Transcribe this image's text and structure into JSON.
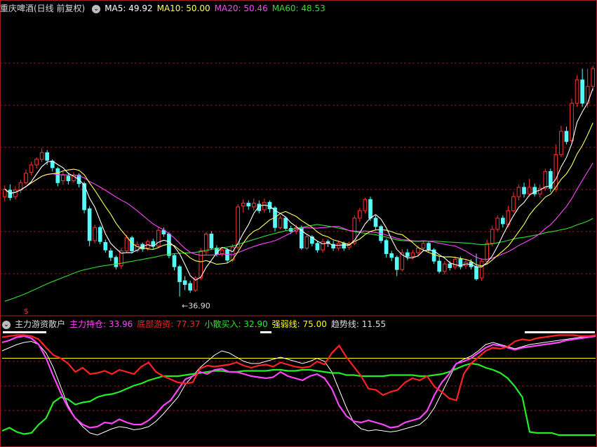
{
  "main_header": {
    "title": "重庆啤酒(日线 前复权)",
    "ma5_label": "MA5: 49.92",
    "ma10_label": "MA10: 50.00",
    "ma20_label": "MA20: 50.46",
    "ma60_label": "MA60: 48.53",
    "min_price_label": "←36.90"
  },
  "sub_header": {
    "title": "主力游资散户",
    "l1": "主力持仓: 33.96",
    "l2": "底部游资: 77.37",
    "l3": "小散买入: 32.90",
    "l4": "强弱线: 75.00",
    "l5": "趋势线: 11.55",
    "marker": "$"
  },
  "colors": {
    "up": "#ff3232",
    "down": "#54fcfc",
    "ma5": "#ffffff",
    "ma10": "#ffff55",
    "ma20": "#ff44ff",
    "ma60": "#33dd33",
    "zhuli": "#ff44ff",
    "youzi": "#ff2222",
    "xiaosan": "#22ee22",
    "qiangruo": "#ffff00",
    "qushi": "#ffffff",
    "grid": "#8b1a1a"
  },
  "chart_data": [
    {
      "type": "candlestick",
      "title": "重庆啤酒(日线 前复权)",
      "ylim": [
        35,
        67
      ],
      "annotations": [
        {
          "label": "←36.90",
          "value": 36.9
        }
      ],
      "candles": [
        [
          47.6,
          48.4,
          47.1,
          48.8
        ],
        [
          48.3,
          47.5,
          47.2,
          48.9
        ],
        [
          47.6,
          48.3,
          47.3,
          48.7
        ],
        [
          48.3,
          49.1,
          48.0,
          49.4
        ],
        [
          49.1,
          50.1,
          48.9,
          50.5
        ],
        [
          50.2,
          51.0,
          49.9,
          51.3
        ],
        [
          51.0,
          51.6,
          50.6,
          51.8
        ],
        [
          51.6,
          52.3,
          51.3,
          52.8
        ],
        [
          52.3,
          51.5,
          51.0,
          52.6
        ],
        [
          51.4,
          50.7,
          50.3,
          51.6
        ],
        [
          50.6,
          49.1,
          48.7,
          50.8
        ],
        [
          49.3,
          49.9,
          48.9,
          50.3
        ],
        [
          49.8,
          49.3,
          48.9,
          50.1
        ],
        [
          49.3,
          49.9,
          49.1,
          50.2
        ],
        [
          49.9,
          49.0,
          48.6,
          50.1
        ],
        [
          49.0,
          46.2,
          45.8,
          49.2
        ],
        [
          46.3,
          42.9,
          42.3,
          46.6
        ],
        [
          42.9,
          44.3,
          42.6,
          44.6
        ],
        [
          44.3,
          42.8,
          42.5,
          44.5
        ],
        [
          42.7,
          41.9,
          41.6,
          43.0
        ],
        [
          41.8,
          41.1,
          40.7,
          42.1
        ],
        [
          41.1,
          40.1,
          39.8,
          41.3
        ],
        [
          40.2,
          41.8,
          39.9,
          42.1
        ],
        [
          41.8,
          43.2,
          41.6,
          43.5
        ],
        [
          43.2,
          41.8,
          41.5,
          43.4
        ],
        [
          41.8,
          42.5,
          41.6,
          42.8
        ],
        [
          42.5,
          42.0,
          41.7,
          42.7
        ],
        [
          42.1,
          42.8,
          41.8,
          43.0
        ],
        [
          42.8,
          42.3,
          42.0,
          43.1
        ],
        [
          42.3,
          44.0,
          42.1,
          44.3
        ],
        [
          44.0,
          43.6,
          43.3,
          44.3
        ],
        [
          43.6,
          41.3,
          41.0,
          43.8
        ],
        [
          41.3,
          40.1,
          39.7,
          41.5
        ],
        [
          40.1,
          38.5,
          36.9,
          40.3
        ],
        [
          38.6,
          38.2,
          37.6,
          39.1
        ],
        [
          38.3,
          37.6,
          37.3,
          38.6
        ],
        [
          37.6,
          38.9,
          37.4,
          39.1
        ],
        [
          38.9,
          41.8,
          38.7,
          42.1
        ],
        [
          41.7,
          43.6,
          41.4,
          43.8
        ],
        [
          43.6,
          42.1,
          41.9,
          43.9
        ],
        [
          42.1,
          41.5,
          41.2,
          42.4
        ],
        [
          41.5,
          41.9,
          41.2,
          42.2
        ],
        [
          41.9,
          40.8,
          40.5,
          42.1
        ],
        [
          40.8,
          42.2,
          40.6,
          42.5
        ],
        [
          42.2,
          46.5,
          41.9,
          46.8
        ],
        [
          46.6,
          46.9,
          45.9,
          47.3
        ],
        [
          46.9,
          46.6,
          46.2,
          47.2
        ],
        [
          46.5,
          46.9,
          46.1,
          47.4
        ],
        [
          46.8,
          46.1,
          45.8,
          47.2
        ],
        [
          46.2,
          47.0,
          45.9,
          47.4
        ],
        [
          47.0,
          46.3,
          45.9,
          47.2
        ],
        [
          46.4,
          44.3,
          43.9,
          46.6
        ],
        [
          44.3,
          45.3,
          44.1,
          45.6
        ],
        [
          45.3,
          44.2,
          43.9,
          45.5
        ],
        [
          44.2,
          43.9,
          43.6,
          44.5
        ],
        [
          43.9,
          44.3,
          43.6,
          44.6
        ],
        [
          44.3,
          42.1,
          41.9,
          44.5
        ],
        [
          42.1,
          43.3,
          41.9,
          43.6
        ],
        [
          43.3,
          42.6,
          42.3,
          43.5
        ],
        [
          42.6,
          41.9,
          41.6,
          42.8
        ],
        [
          41.9,
          42.8,
          41.6,
          43.1
        ],
        [
          42.8,
          42.6,
          42.2,
          43.0
        ],
        [
          42.5,
          42.1,
          41.8,
          42.9
        ],
        [
          42.1,
          42.6,
          41.8,
          42.8
        ],
        [
          42.6,
          42.1,
          41.8,
          42.8
        ],
        [
          42.2,
          42.6,
          41.9,
          42.8
        ],
        [
          42.6,
          45.3,
          42.4,
          45.6
        ],
        [
          45.3,
          46.1,
          44.9,
          46.4
        ],
        [
          46.1,
          47.3,
          45.8,
          47.5
        ],
        [
          47.3,
          45.3,
          45.0,
          47.6
        ],
        [
          45.3,
          44.4,
          44.0,
          45.6
        ],
        [
          44.4,
          42.9,
          42.6,
          44.6
        ],
        [
          42.9,
          41.5,
          41.1,
          43.1
        ],
        [
          41.5,
          41.1,
          40.7,
          41.8
        ],
        [
          41.1,
          39.8,
          39.1,
          41.3
        ],
        [
          39.8,
          41.6,
          39.6,
          42.0
        ],
        [
          41.6,
          41.2,
          40.8,
          42.0
        ],
        [
          41.2,
          41.6,
          40.9,
          41.9
        ],
        [
          41.6,
          42.1,
          41.2,
          42.4
        ],
        [
          42.1,
          42.6,
          41.8,
          42.8
        ],
        [
          42.6,
          41.9,
          41.6,
          42.8
        ],
        [
          41.9,
          40.7,
          40.4,
          42.1
        ],
        [
          40.7,
          39.6,
          39.4,
          41.2
        ],
        [
          39.6,
          40.4,
          39.3,
          40.7
        ],
        [
          40.4,
          40.0,
          39.7,
          40.7
        ],
        [
          40.1,
          40.9,
          39.8,
          41.2
        ],
        [
          40.9,
          40.1,
          39.8,
          41.2
        ],
        [
          40.2,
          40.6,
          39.9,
          40.9
        ],
        [
          40.6,
          40.1,
          39.8,
          40.9
        ],
        [
          40.1,
          38.8,
          38.6,
          41.5
        ],
        [
          38.9,
          40.7,
          38.6,
          41.0
        ],
        [
          40.7,
          42.6,
          40.4,
          43.0
        ],
        [
          42.6,
          44.1,
          42.3,
          44.5
        ],
        [
          44.1,
          45.3,
          43.9,
          45.6
        ],
        [
          45.3,
          44.7,
          44.3,
          45.6
        ],
        [
          44.6,
          46.1,
          44.3,
          46.6
        ],
        [
          46.1,
          47.6,
          45.9,
          48.1
        ],
        [
          47.6,
          48.6,
          47.2,
          48.9
        ],
        [
          48.6,
          47.9,
          47.5,
          49.1
        ],
        [
          47.9,
          48.6,
          47.6,
          49.5
        ],
        [
          48.6,
          47.9,
          47.6,
          49.0
        ],
        [
          47.9,
          48.5,
          47.5,
          48.9
        ],
        [
          48.5,
          50.3,
          48.2,
          50.6
        ],
        [
          50.3,
          48.5,
          48.1,
          50.6
        ],
        [
          48.4,
          52.1,
          48.1,
          53.2
        ],
        [
          52.1,
          54.6,
          51.8,
          55.2
        ],
        [
          54.6,
          53.5,
          53.2,
          55.1
        ],
        [
          53.6,
          57.6,
          53.3,
          58.1
        ],
        [
          57.6,
          60.1,
          57.2,
          60.6
        ],
        [
          60.1,
          57.6,
          57.2,
          61.3
        ],
        [
          57.6,
          59.4,
          57.1,
          61.3
        ],
        [
          59.4,
          61.3,
          58.9,
          61.6
        ]
      ]
    },
    {
      "type": "line",
      "title": "主力游资散户",
      "ylim": [
        -6,
        100
      ],
      "series": [
        {
          "name": "主力持仓",
          "values": [
            90,
            92,
            95,
            96,
            94,
            88,
            75,
            58,
            42,
            28,
            18,
            12,
            9,
            10,
            14,
            13,
            17,
            14,
            12,
            12,
            16,
            22,
            30,
            35,
            45,
            55,
            58,
            62,
            60,
            64,
            65,
            62,
            62,
            60,
            58,
            57,
            56,
            57,
            62,
            58,
            56,
            54,
            58,
            60,
            56,
            46,
            30,
            20,
            15,
            14,
            16,
            14,
            12,
            9,
            10,
            14,
            16,
            18,
            25,
            40,
            52,
            60,
            70,
            72,
            75,
            80,
            85,
            88,
            87,
            85,
            83,
            85,
            86,
            87,
            88,
            89,
            90,
            92,
            93,
            94,
            95,
            96
          ]
        },
        {
          "name": "底部游资",
          "values": [
            95,
            96,
            97,
            97,
            96,
            93,
            85,
            78,
            75,
            70,
            62,
            66,
            60,
            61,
            63,
            60,
            64,
            62,
            60,
            67,
            71,
            62,
            58,
            55,
            52,
            51,
            52,
            65,
            68,
            67,
            68,
            69,
            71,
            68,
            66,
            68,
            69,
            67,
            71,
            69,
            67,
            66,
            67,
            72,
            69,
            80,
            87,
            76,
            67,
            58,
            46,
            45,
            40,
            43,
            45,
            52,
            56,
            54,
            58,
            48,
            43,
            37,
            35,
            60,
            70,
            76,
            82,
            85,
            84,
            86,
            91,
            93,
            92,
            94,
            95,
            96,
            97,
            97,
            97,
            96,
            96,
            97
          ]
        },
        {
          "name": "小散买入",
          "values": [
            6,
            9,
            5,
            3,
            4,
            12,
            18,
            33,
            38,
            36,
            31,
            33,
            34,
            38,
            40,
            41,
            43,
            46,
            49,
            51,
            54,
            56,
            58,
            58,
            58,
            59,
            60,
            61,
            62,
            63,
            63,
            62,
            62,
            63,
            63,
            63,
            63,
            64,
            64,
            63,
            63,
            64,
            64,
            63,
            62,
            61,
            61,
            59,
            59,
            58,
            58,
            58,
            58,
            59,
            59,
            59,
            59,
            58,
            58,
            59,
            60,
            62,
            65,
            68,
            70,
            69,
            66,
            64,
            61,
            56,
            48,
            38,
            5,
            4,
            4,
            4,
            2,
            2,
            2,
            2,
            2,
            2
          ]
        },
        {
          "name": "强弱线",
          "values": [
            75,
            75,
            75,
            75,
            75,
            75,
            75,
            75,
            75,
            75,
            75,
            75,
            75,
            75,
            75,
            75,
            75,
            75,
            75,
            75,
            75,
            75,
            75,
            75,
            75,
            75,
            75,
            75,
            75,
            75,
            75,
            75,
            75,
            75,
            75,
            75,
            75,
            75,
            75,
            75,
            75,
            75,
            75,
            75,
            75,
            75,
            75,
            75,
            75,
            75,
            75,
            75,
            75,
            75,
            75,
            75,
            75,
            75,
            75,
            75,
            75,
            75,
            75,
            75,
            75,
            75,
            75,
            75,
            75,
            75,
            75,
            75,
            75,
            75,
            75,
            75,
            75,
            75,
            75,
            75,
            75,
            75
          ]
        },
        {
          "name": "趋势线",
          "values": [
            82,
            85,
            88,
            90,
            91,
            88,
            80,
            66,
            48,
            30,
            18,
            10,
            4,
            2,
            5,
            8,
            10,
            9,
            7,
            8,
            10,
            15,
            22,
            30,
            38,
            50,
            58,
            66,
            72,
            78,
            82,
            80,
            76,
            72,
            70,
            70,
            72,
            74,
            76,
            74,
            72,
            70,
            72,
            75,
            72,
            62,
            45,
            28,
            14,
            8,
            6,
            7,
            6,
            5,
            6,
            8,
            10,
            12,
            18,
            28,
            42,
            56,
            70,
            74,
            77,
            82,
            88,
            90,
            88,
            86,
            84,
            86,
            88,
            89,
            90,
            91,
            92,
            93,
            94,
            95,
            96,
            97
          ]
        }
      ]
    }
  ]
}
